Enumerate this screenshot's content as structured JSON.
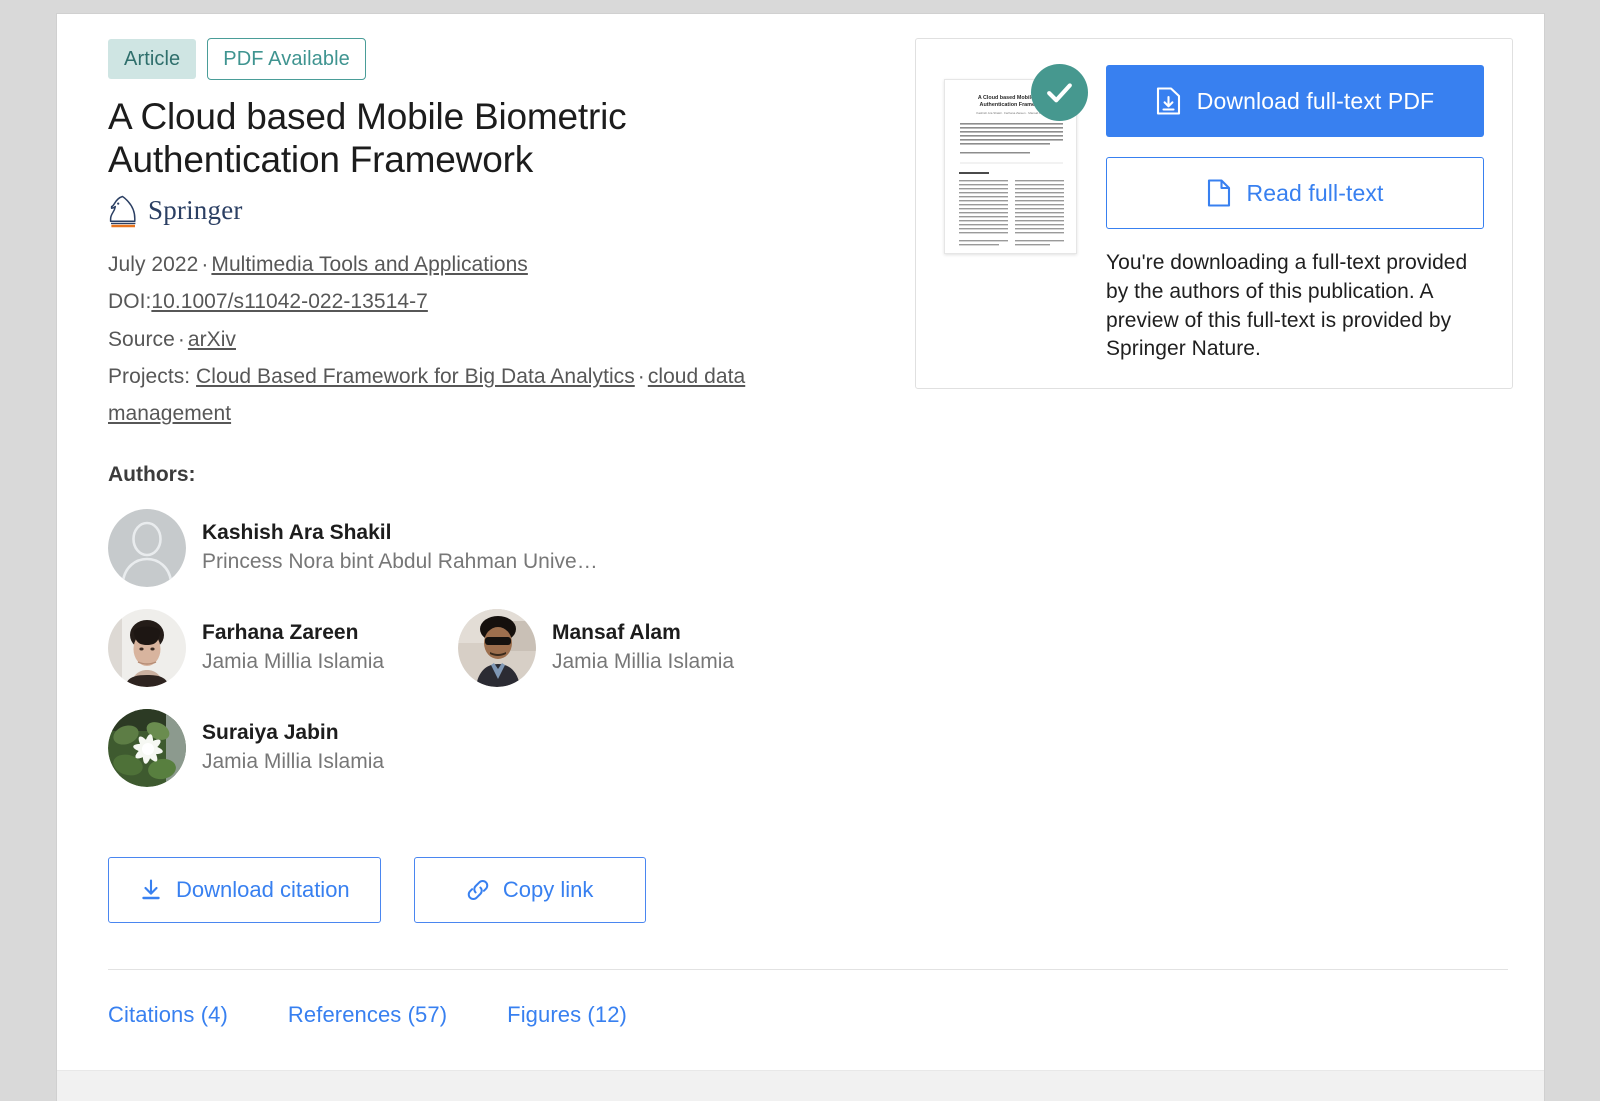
{
  "badges": {
    "type_label": "Article",
    "pdf_label": "PDF Available"
  },
  "publication": {
    "title": "A Cloud based Mobile Biometric Authentication Framework",
    "publisher": "Springer",
    "date": "July 2022",
    "separator": "·",
    "journal": "Multimedia Tools and Applications",
    "doi_label": "DOI:",
    "doi_value": "10.1007/s11042-022-13514-7",
    "source_label": "Source",
    "source_value": "arXiv",
    "projects_label": "Projects:",
    "projects": [
      "Cloud Based Framework for Big Data Analytics",
      "cloud data management"
    ]
  },
  "authors_section": {
    "heading": "Authors:",
    "authors": [
      {
        "name": "Kashish Ara Shakil",
        "affiliation": "Princess Nora bint Abdul Rahman Unive…",
        "avatar": "placeholder-avatar-icon"
      },
      {
        "name": "Farhana Zareen",
        "affiliation": "Jamia Millia Islamia",
        "avatar": "photo-avatar"
      },
      {
        "name": "Mansaf Alam",
        "affiliation": "Jamia Millia Islamia",
        "avatar": "photo-avatar"
      },
      {
        "name": "Suraiya Jabin",
        "affiliation": "Jamia Millia Islamia",
        "avatar": "photo-avatar"
      }
    ]
  },
  "fulltext_card": {
    "thumbnail_title_line1": "A Cloud based Mobile Bio",
    "thumbnail_title_line2": "Authentication Framewo",
    "verified_icon": "check-circle-icon",
    "download_button": {
      "label": "Download full-text PDF",
      "icon": "file-download-icon"
    },
    "read_button": {
      "label": "Read full-text",
      "icon": "file-icon"
    },
    "note": "You're downloading a full-text provided by the authors of this publication. A preview of this full-text is provided by Springer Nature."
  },
  "actions": {
    "download_citation": {
      "label": "Download citation",
      "icon": "download-icon"
    },
    "copy_link": {
      "label": "Copy link",
      "icon": "link-icon"
    }
  },
  "tabs": [
    {
      "label": "Citations (4)"
    },
    {
      "label": "References (57)"
    },
    {
      "label": "Figures (12)"
    }
  ],
  "colors": {
    "primary_blue": "#3880f0",
    "teal": "#46988f",
    "badge_bg": "#cfe5e3",
    "badge_text": "#2f6f6c",
    "springer_navy": "#2b3f63",
    "springer_orange": "#e8741e",
    "page_bg": "#d9d9d9"
  }
}
